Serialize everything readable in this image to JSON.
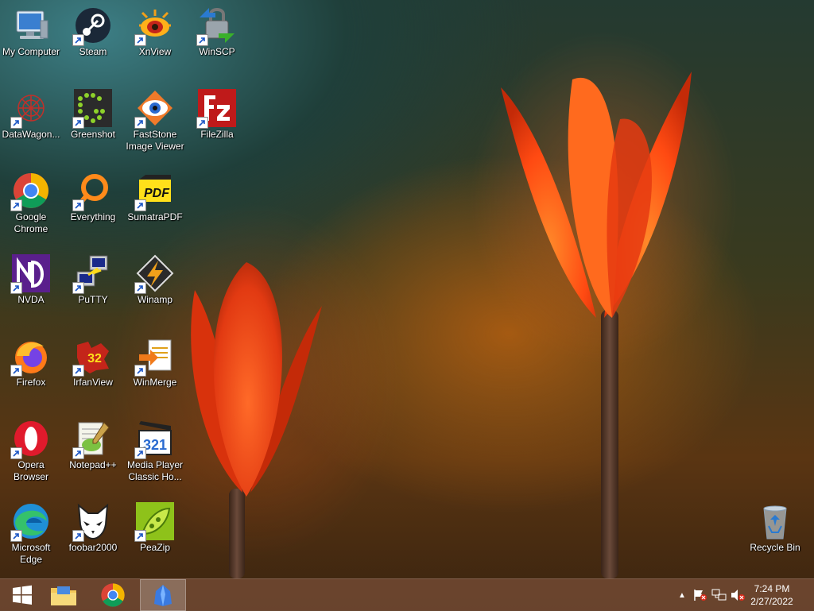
{
  "desktop": {
    "icons": [
      {
        "label": "My Computer"
      },
      {
        "label": "Steam"
      },
      {
        "label": "XnView"
      },
      {
        "label": "WinSCP"
      },
      {
        "label": "DataWagon..."
      },
      {
        "label": "Greenshot"
      },
      {
        "label": "FastStone Image Viewer"
      },
      {
        "label": "FileZilla"
      },
      {
        "label": "Google Chrome"
      },
      {
        "label": "Everything"
      },
      {
        "label": "SumatraPDF"
      },
      {
        "label": "NVDA"
      },
      {
        "label": "PuTTY"
      },
      {
        "label": "Winamp"
      },
      {
        "label": "Firefox"
      },
      {
        "label": "IrfanView"
      },
      {
        "label": "WinMerge"
      },
      {
        "label": "Opera Browser"
      },
      {
        "label": "Notepad++"
      },
      {
        "label": "Media Player Classic Ho..."
      },
      {
        "label": "Microsoft Edge"
      },
      {
        "label": "foobar2000"
      },
      {
        "label": "PeaZip"
      },
      {
        "label": "Recycle Bin"
      }
    ],
    "icon_glyphs": {
      "sumatra": "PDF",
      "irfan": "32",
      "mpc": "321"
    }
  },
  "taskbar": {
    "clock_time": "7:24 PM",
    "clock_date": "2/27/2022",
    "colors": {
      "background": "#6e4630",
      "accent": "#ffffff"
    }
  }
}
